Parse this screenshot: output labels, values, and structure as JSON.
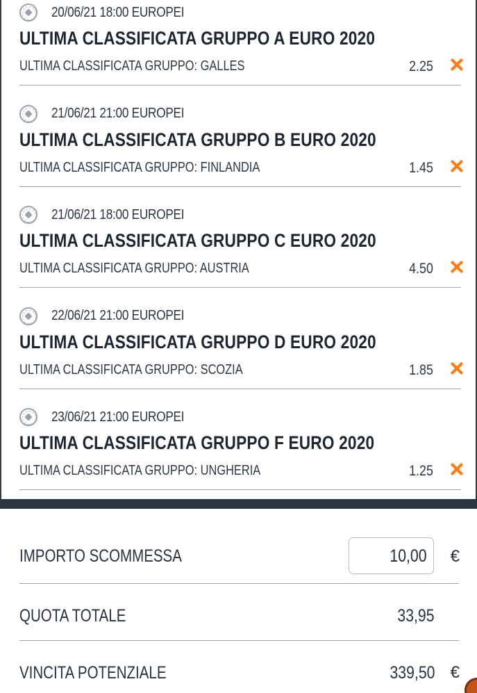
{
  "bets": [
    {
      "datetime": "20/06/21 18:00 EUROPEI",
      "title": "ULTIMA CLASSIFICATA GRUPPO A EURO 2020",
      "selection": "ULTIMA CLASSIFICATA GRUPPO: GALLES",
      "odd": "2.25"
    },
    {
      "datetime": "21/06/21 21:00 EUROPEI",
      "title": "ULTIMA CLASSIFICATA GRUPPO B EURO 2020",
      "selection": "ULTIMA CLASSIFICATA GRUPPO: FINLANDIA",
      "odd": "1.45"
    },
    {
      "datetime": "21/06/21 18:00 EUROPEI",
      "title": "ULTIMA CLASSIFICATA GRUPPO C EURO 2020",
      "selection": "ULTIMA CLASSIFICATA GRUPPO: AUSTRIA",
      "odd": "4.50"
    },
    {
      "datetime": "22/06/21 21:00 EUROPEI",
      "title": "ULTIMA CLASSIFICATA GRUPPO D EURO 2020",
      "selection": "ULTIMA CLASSIFICATA GRUPPO: SCOZIA",
      "odd": "1.85"
    },
    {
      "datetime": "23/06/21 21:00 EUROPEI",
      "title": "ULTIMA CLASSIFICATA GRUPPO F EURO 2020",
      "selection": "ULTIMA CLASSIFICATA GRUPPO: UNGHERIA",
      "odd": "1.25"
    }
  ],
  "summary": {
    "stake_label": "IMPORTO SCOMMESSA",
    "stake_value": "10,00",
    "stake_currency": "€",
    "total_odds_label": "QUOTA TOTALE",
    "total_odds_value": "33,95",
    "potential_win_label": "VINCITA POTENZIALE",
    "potential_win_value": "339,50",
    "potential_win_currency": "€"
  },
  "colors": {
    "accent": "#ff7a14",
    "text": "#1f2d3d",
    "divider": "#9aa3aa",
    "dark_bar": "#2b3540"
  },
  "icons": {
    "sport": "soccer-ball-icon",
    "remove": "close-x-icon"
  }
}
